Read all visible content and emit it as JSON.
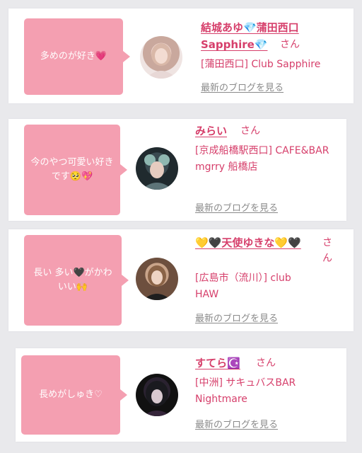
{
  "entries": [
    {
      "comment": "多めのが好き💗",
      "name_line1": "結城あゆ💎蒲田西口",
      "name_line2": "Sapphire💎",
      "suffix": "さん",
      "shop": "[蒲田西口] Club Sapphire",
      "blog_link": "最新のブログを見る",
      "avatar_icon": "portrait-photo"
    },
    {
      "comment": "今のやつ可愛い好きです🥺💖",
      "name_line1": "みらい",
      "suffix": "さん",
      "shop": "[京成船橋駅西口] CAFE&BAR mgrry 船橋店",
      "blog_link": "最新のブログを見る",
      "avatar_icon": "portrait-photo"
    },
    {
      "comment": "長い 多い🖤がかわいい🙌",
      "name_line1": "💛🖤天使ゆきな💛🖤",
      "suffix": "さん",
      "shop": "[広島市（流川）] club HAW",
      "blog_link": "最新のブログを見る",
      "avatar_icon": "portrait-photo"
    },
    {
      "comment": "長めがしゅき♡",
      "name_line1": "すてら☪️",
      "suffix": "さん",
      "shop": "[中洲] サキュバスBAR Nightmare",
      "blog_link": "最新のブログを見る",
      "avatar_icon": "portrait-photo"
    }
  ],
  "colors": {
    "bubble": "#f49fb1",
    "name": "#d63f6b",
    "link": "#8a8a8a",
    "background": "#e9e9ec"
  }
}
